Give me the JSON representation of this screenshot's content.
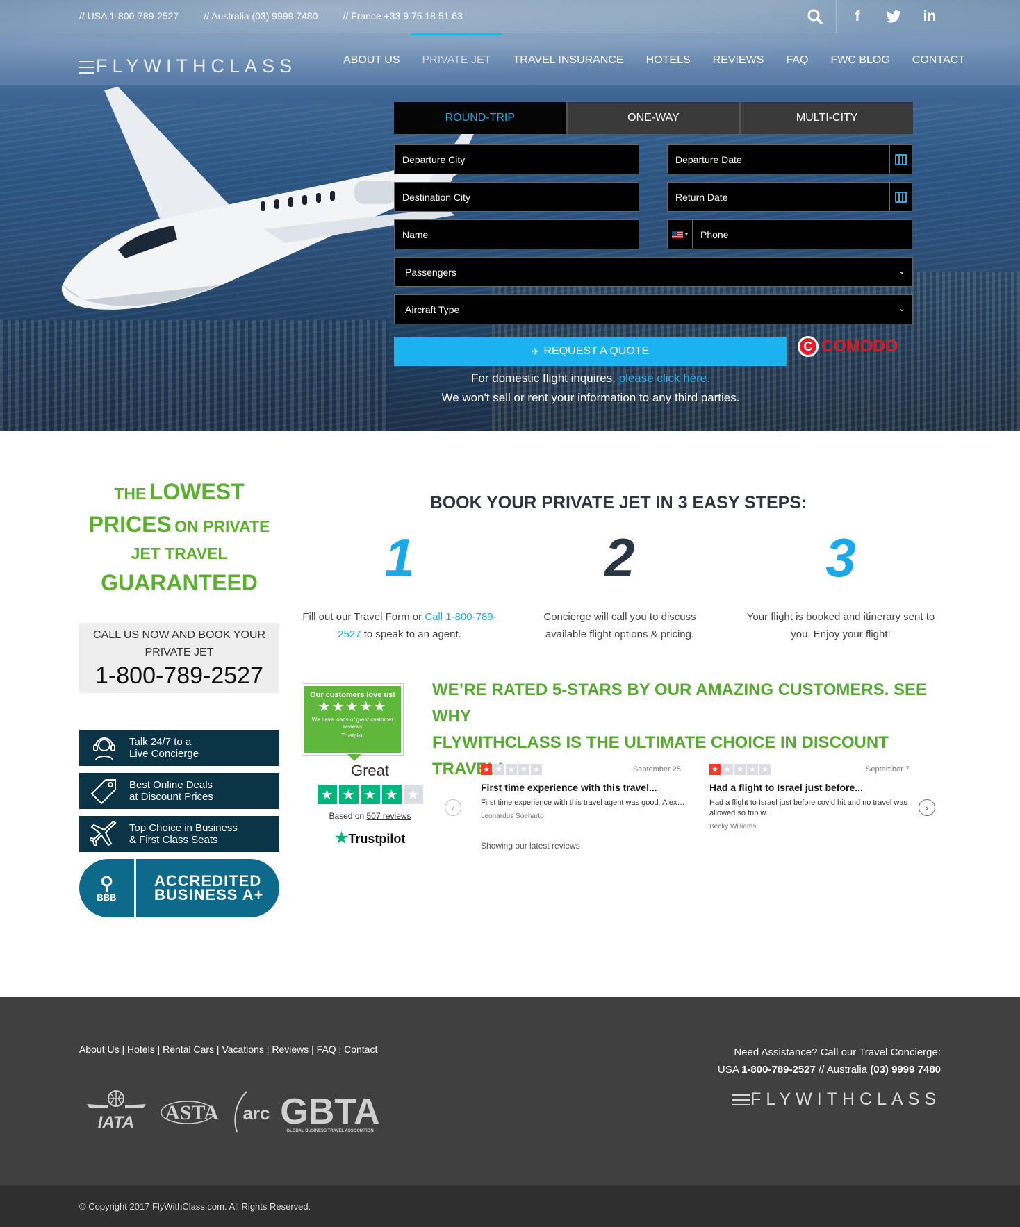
{
  "topbar": {
    "phones": [
      "// USA 1-800-789-2527",
      "// Australia (03) 9999 7480",
      "// France +33 9 75 18 51 63"
    ],
    "icons": [
      "search-icon",
      "facebook-icon",
      "twitter-icon",
      "linkedin-icon"
    ]
  },
  "brand": {
    "logo": "FLYWITHCLASS"
  },
  "nav": {
    "items": [
      "ABOUT US",
      "PRIVATE JET",
      "TRAVEL INSURANCE",
      "HOTELS",
      "REVIEWS",
      "FAQ",
      "FWC BLOG",
      "CONTACT"
    ],
    "active": "PRIVATE JET"
  },
  "form": {
    "tabs": [
      "ROUND-TRIP",
      "ONE-WAY",
      "MULTI-CITY"
    ],
    "active_tab": "ROUND-TRIP",
    "departure_city": "Departure City",
    "departure_date": "Departure Date",
    "destination_city": "Destination City",
    "return_date": "Return Date",
    "name": "Name",
    "phone": "Phone",
    "passengers": "Passengers",
    "aircraft_type": "Aircraft Type",
    "submit": "REQUEST A QUOTE",
    "ssl_badge": "COMODO",
    "domestic_text": "For domestic flight inquires,",
    "domestic_link": "please click here.",
    "privacy_text": "We won't sell or rent your information to any third parties."
  },
  "promo": {
    "line1_small": "THE",
    "line1_big": "LOWEST",
    "line2_big": "PRICES",
    "line2_small": "ON PRIVATE",
    "line3": "JET TRAVEL",
    "line4": "GUARANTEED",
    "call_label_1": "CALL US NOW AND BOOK YOUR",
    "call_label_2": "PRIVATE JET",
    "call_phone": "1-800-789-2527"
  },
  "perks": [
    {
      "line1": "Talk 24/7 to a",
      "line2": "Live Concierge",
      "icon": "headset-icon"
    },
    {
      "line1": "Best Online Deals",
      "line2": "at Discount Prices",
      "icon": "tag-icon"
    },
    {
      "line1": "Top Choice in Business",
      "line2": "& First Class Seats",
      "icon": "plane-icon"
    }
  ],
  "bbb": {
    "logo": "BBB",
    "line1": "ACCREDITED",
    "line2": "BUSINESS A+"
  },
  "steps": {
    "title": "BOOK YOUR PRIVATE JET IN 3 EASY STEPS:",
    "items": [
      {
        "num": "1",
        "text_before": "Fill out our Travel Form or ",
        "link": "Call 1-800-789-2527",
        "text_after": " to speak to an agent.",
        "color": "#1ba8e8"
      },
      {
        "num": "2",
        "text": "Concierge will call you to discuss available flight options & pricing.",
        "color": "#2b3645"
      },
      {
        "num": "3",
        "text": "Your flight is booked and itinerary sent to you. Enjoy your flight!",
        "color": "#1ba8e8"
      }
    ]
  },
  "rated": {
    "line1": "WE’RE RATED 5-STARS BY OUR AMAZING CUSTOMERS. SEE WHY",
    "line2": "FLYWITHCLASS IS THE ULTIMATE CHOICE IN DISCOUNT TRAVEL!"
  },
  "trustpilot": {
    "badge_title": "Our customers love us!",
    "badge_stars": "★★★★★",
    "badge_text": "We have loads of great customer reviews",
    "badge_brand": "Trustpilot",
    "score_word": "Great",
    "stars_filled": 4,
    "stars_total": 5,
    "based_on": "Based on",
    "review_count": "507 reviews",
    "brand": "Trustpilot",
    "showing": "Showing our latest reviews",
    "reviews": [
      {
        "rating": 1,
        "date": "September 25",
        "title": "First time experience with this travel...",
        "body": "First time experience with this travel agent was good. Alex…",
        "author": "Leonardus Soeharto"
      },
      {
        "rating": 1,
        "date": "September 7",
        "title": "Had a flight to Israel just before...",
        "body": "Had a flight to Israel just before covid hit and no travel was allowed so trip w...",
        "author": "Becky Williams"
      }
    ]
  },
  "footer": {
    "links": [
      "About Us",
      "Hotels",
      "Rental Cars",
      "Vacations",
      "Reviews",
      "FAQ",
      "Contact"
    ],
    "need_line1": "Need Assistance? Call our Travel Concierge:",
    "usa_label": "USA",
    "usa_phone": "1-800-789-2527",
    "sep": "//",
    "aus_label": "Australia",
    "aus_phone": "(03) 9999 7480",
    "logo": "FLYWITHCLASS",
    "associations": [
      "IATA",
      "ASTA",
      "arc",
      "GBTA"
    ],
    "gbta_caption": "GLOBAL BUSINESS TRAVEL ASSOCIATION",
    "copyright": "© Copyright 2017 FlyWithClass.com. All Rights Reserved."
  }
}
